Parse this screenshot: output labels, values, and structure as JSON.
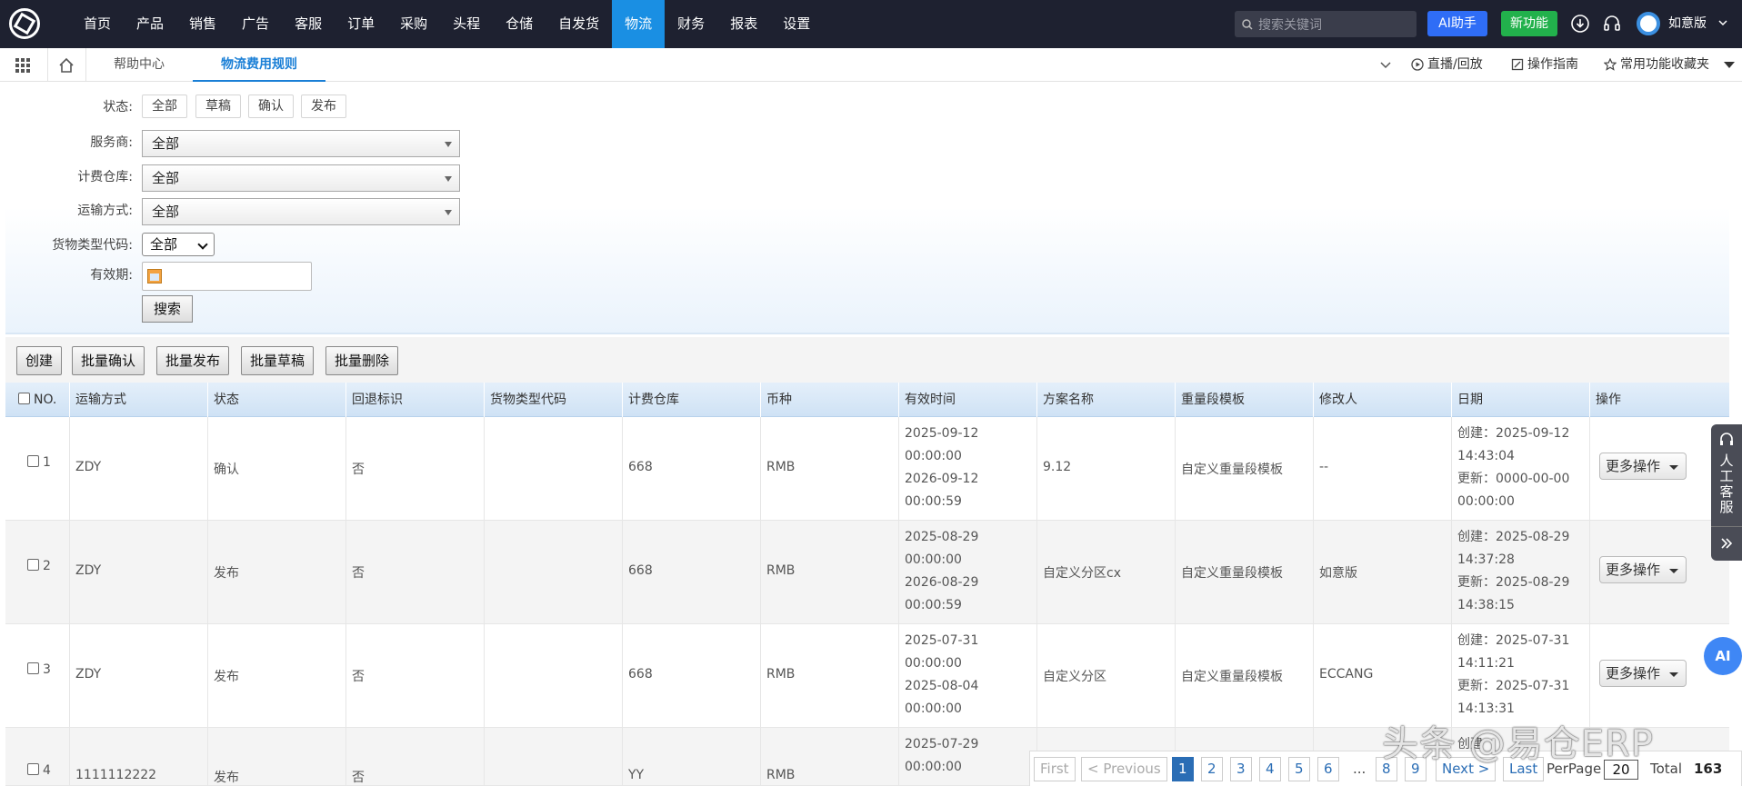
{
  "nav": {
    "items": [
      "首页",
      "产品",
      "销售",
      "广告",
      "客服",
      "订单",
      "采购",
      "头程",
      "仓储",
      "自发货",
      "物流",
      "财务",
      "报表",
      "设置"
    ],
    "active_index": 10,
    "search_placeholder": "搜索关键词",
    "ai_label": "AI助手",
    "new_label": "新功能",
    "user_name": "如意版"
  },
  "tabs": {
    "items": [
      "帮助中心",
      "物流费用规则"
    ],
    "active_index": 1,
    "live_label": "直播/回放",
    "guide_label": "操作指南",
    "favorites_label": "常用功能收藏夹"
  },
  "filter": {
    "status_label": "状态:",
    "status_options": [
      "全部",
      "草稿",
      "确认",
      "发布"
    ],
    "provider_label": "服务商:",
    "provider_value": "全部",
    "warehouse_label": "计费仓库:",
    "warehouse_value": "全部",
    "transport_label": "运输方式:",
    "transport_value": "全部",
    "cargo_label": "货物类型代码:",
    "cargo_value": "全部",
    "validity_label": "有效期:",
    "search_button": "搜索"
  },
  "toolbar": [
    "创建",
    "批量确认",
    "批量发布",
    "批量草稿",
    "批量删除"
  ],
  "table": {
    "headers": [
      "NO.",
      "运输方式",
      "状态",
      "回退标识",
      "货物类型代码",
      "计费仓库",
      "币种",
      "有效时间",
      "方案名称",
      "重量段模板",
      "修改人",
      "日期",
      "操作"
    ],
    "rows": [
      {
        "no": "1",
        "transport": "ZDY",
        "status": "确认",
        "rollback": "否",
        "cargo": "",
        "warehouse": "668",
        "currency": "RMB",
        "valid": [
          "2025-09-12",
          "00:00:00",
          "2026-09-12",
          "00:00:59"
        ],
        "plan": "9.12",
        "template": "自定义重量段模板",
        "modifier": "--",
        "date": [
          "创建：2025-09-12",
          "14:43:04",
          "更新：0000-00-00",
          "00:00:00"
        ],
        "action": "更多操作"
      },
      {
        "no": "2",
        "transport": "ZDY",
        "status": "发布",
        "rollback": "否",
        "cargo": "",
        "warehouse": "668",
        "currency": "RMB",
        "valid": [
          "2025-08-29",
          "00:00:00",
          "2026-08-29",
          "00:00:59"
        ],
        "plan": "自定义分区cx",
        "template": "自定义重量段模板",
        "modifier": "如意版",
        "date": [
          "创建：2025-08-29",
          "14:37:28",
          "更新：2025-08-29",
          "14:38:15"
        ],
        "action": "更多操作"
      },
      {
        "no": "3",
        "transport": "ZDY",
        "status": "发布",
        "rollback": "否",
        "cargo": "",
        "warehouse": "668",
        "currency": "RMB",
        "valid": [
          "2025-07-31",
          "00:00:00",
          "2025-08-04",
          "00:00:00"
        ],
        "plan": "自定义分区",
        "template": "自定义重量段模板",
        "modifier": "ECCANG",
        "date": [
          "创建：2025-07-31",
          "14:11:21",
          "更新：2025-07-31",
          "14:13:31"
        ],
        "action": "更多操作"
      },
      {
        "no": "4",
        "transport": "1111112222",
        "status": "发布",
        "rollback": "否",
        "cargo": "",
        "warehouse": "YY",
        "currency": "RMB",
        "valid": [
          "2025-07-29",
          "00:00:00"
        ],
        "plan": "",
        "template": "",
        "modifier": "",
        "date": [
          "创建"
        ],
        "action": ""
      }
    ]
  },
  "pager": {
    "first": "First",
    "prev": "< Previous",
    "pages": [
      "1",
      "2",
      "3",
      "4",
      "5",
      "6",
      "...",
      "8",
      "9"
    ],
    "current": "1",
    "next": "Next >",
    "last": "Last",
    "per_page_label": "PerPage",
    "per_page": "20",
    "total_label": "Total",
    "total": "163"
  },
  "float": {
    "cs_label": "人工客服",
    "ai_label": "AI"
  },
  "watermark": "头条 @易仓ERP",
  "colors": {
    "nav_bg": "#1e2130",
    "nav_active": "#1a8fe3",
    "ai_button": "#2f6df6",
    "new_button": "#22b14c",
    "link": "#2a6db5"
  }
}
